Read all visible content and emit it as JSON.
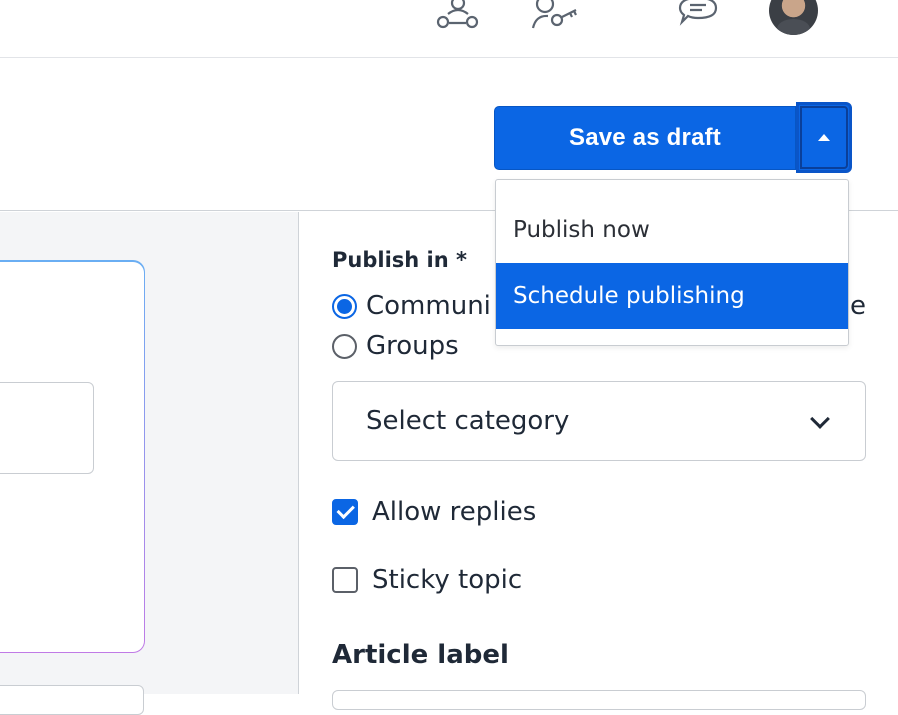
{
  "header": {
    "icons": [
      "community-icon",
      "user-key-icon",
      "chat-icon"
    ],
    "avatar": "avatar"
  },
  "actions": {
    "save_label": "Save as draft",
    "menu": [
      {
        "label": "Publish now",
        "active": false
      },
      {
        "label": "Schedule publishing",
        "active": true
      }
    ]
  },
  "publish": {
    "label": "Publish in *",
    "options": [
      {
        "label": "Communi",
        "selected": true
      },
      {
        "label": "Groups",
        "selected": false
      }
    ],
    "hidden_tail": "e"
  },
  "category": {
    "placeholder": "Select category"
  },
  "settings": {
    "allow_replies": {
      "label": "Allow replies",
      "checked": true
    },
    "sticky_topic": {
      "label": "Sticky topic",
      "checked": false
    }
  },
  "article_label": {
    "title": "Article label"
  },
  "colors": {
    "primary": "#0b66e4",
    "border": "#c9cdd2",
    "panel": "#f4f5f7"
  }
}
